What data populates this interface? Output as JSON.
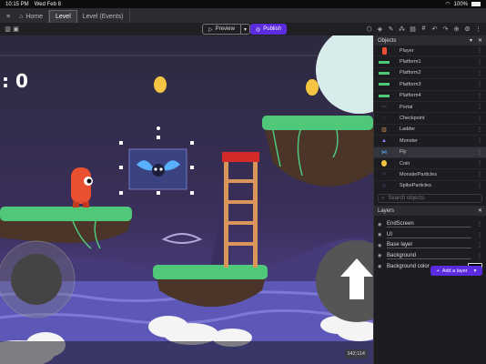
{
  "status": {
    "time": "10:15 PM",
    "date": "Wed Feb 8",
    "battery": "100%"
  },
  "tabs": [
    {
      "label": "Home"
    },
    {
      "label": "Level"
    },
    {
      "label": "Level (Events)"
    }
  ],
  "toolbar": {
    "preview_label": "Preview",
    "publish_label": "Publish"
  },
  "objects_panel": {
    "title": "Objects",
    "items": [
      {
        "label": "Player"
      },
      {
        "label": "Platform1"
      },
      {
        "label": "Platform2"
      },
      {
        "label": "Platform3"
      },
      {
        "label": "Platform4"
      },
      {
        "label": "Portal"
      },
      {
        "label": "Checkpoint"
      },
      {
        "label": "Ladder"
      },
      {
        "label": "Monster"
      },
      {
        "label": "Fly"
      },
      {
        "label": "Coin"
      },
      {
        "label": "MonsterParticles"
      },
      {
        "label": "SpikeParticles"
      }
    ],
    "search_placeholder": "Search objects"
  },
  "layers_panel": {
    "title": "Layers",
    "items": [
      {
        "label": "EndScreen"
      },
      {
        "label": "UI"
      },
      {
        "label": "Base layer"
      },
      {
        "label": "Background"
      }
    ],
    "bg_color_label": "Background color",
    "add_layer_label": "Add a layer"
  },
  "scene": {
    "score": ": 0",
    "cursor_coords": "342;114"
  },
  "colors": {
    "accent": "#5b2be0",
    "grass": "#4fc87a",
    "dirt": "#4a3528"
  }
}
